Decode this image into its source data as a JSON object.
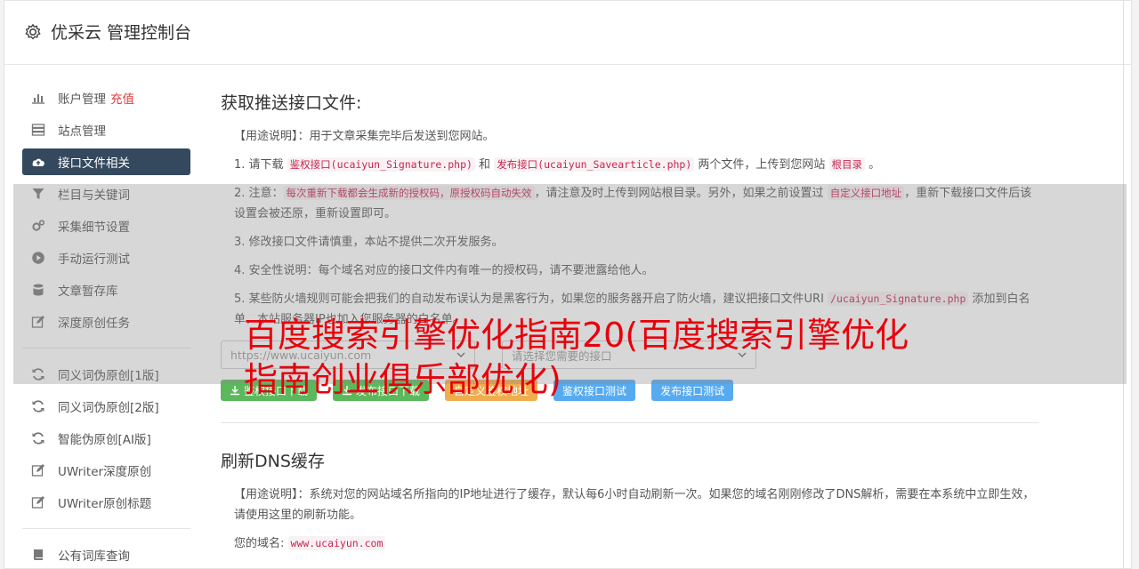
{
  "header": {
    "title": "优采云 管理控制台"
  },
  "sidebar": {
    "items": [
      {
        "label": "账户管理",
        "badge": "充值",
        "icon": "bar-chart-icon"
      },
      {
        "label": "站点管理",
        "icon": "server-icon"
      },
      {
        "label": "接口文件相关",
        "icon": "cloud-upload-icon",
        "active": true
      },
      {
        "label": "栏目与关键词",
        "icon": "filter-icon"
      },
      {
        "label": "采集细节设置",
        "icon": "cogs-icon"
      },
      {
        "label": "手动运行测试",
        "icon": "play-icon"
      },
      {
        "label": "文章暂存库",
        "icon": "database-icon"
      },
      {
        "label": "深度原创任务",
        "icon": "edit-icon"
      },
      {
        "label": "同义词伪原创[1版]",
        "icon": "refresh-icon"
      },
      {
        "label": "同义词伪原创[2版]",
        "icon": "refresh-icon"
      },
      {
        "label": "智能伪原创[AI版]",
        "icon": "refresh-icon"
      },
      {
        "label": "UWriter深度原创",
        "icon": "edit-icon"
      },
      {
        "label": "UWriter原创标题",
        "icon": "edit-icon"
      },
      {
        "label": "公有词库查询",
        "icon": "book-icon"
      }
    ]
  },
  "section1": {
    "title": "获取推送接口文件:",
    "usage": "【用途说明】：用于文章采集完毕后发送到您网站。",
    "step1": {
      "pre": "1. 请下载 ",
      "code1": "鉴权接口(ucaiyun_Signature.php)",
      "mid": " 和 ",
      "code2": "发布接口(ucaiyun_Savearticle.php)",
      "post": " 两个文件，上传到您网站 ",
      "code3": "根目录",
      "end": " 。"
    },
    "step2": {
      "pre": "2. 注意：",
      "code1": "每次重新下载都会生成新的授权码，原授权码自动失效",
      "mid": "，请注意及时上传到网站根目录。另外，如果之前设置过 ",
      "code2": "自定义接口地址",
      "post": "，重新下载接口文件后该设置会被还原，重新设置即可。"
    },
    "step3": "3. 修改接口文件请慎重，本站不提供二次开发服务。",
    "step4": "4. 安全性说明：每个域名对应的接口文件内有唯一的授权码，请不要泄露给他人。",
    "step5": {
      "pre": "5. 某些防火墙规则可能会把我们的自动发布误认为是黑客行为，如果您的服务器开启了防火墙，建议把接口文件URI ",
      "code1": "/ucaiyun_Signature.php",
      "post": " 添加到白名单，本站服务器IP也加入您服务器的白名单。"
    },
    "select_site": "https://www.ucaiyun.com",
    "select_api": "请选择您需要的接口",
    "buttons": {
      "sig_download": "鉴权接口下载",
      "pub_download": "发布接口下载",
      "custom_sig": "自定义鉴权地址",
      "sig_test": "鉴权接口测试",
      "pub_test": "发布接口测试"
    }
  },
  "section2": {
    "title": "刷新DNS缓存",
    "usage": "【用途说明】：系统对您的网站域名所指向的IP地址进行了缓存，默认每6小时自动刷新一次。如果您的域名刚刚修改了DNS解析，需要在本系统中立即生效，请使用这里的刷新功能。",
    "domain_label": "您的域名:",
    "domain_value": "www.ucaiyun.com"
  },
  "overlay": {
    "title": "百度搜索引擎优化指南20(百度搜索引擎优化指南创业俱乐部优化)"
  },
  "colors": {
    "sidebar_active": "#34495e",
    "accent_red": "#e8000b",
    "green": "#5cb85c",
    "orange": "#f0ad4e",
    "blue": "#5bc0de"
  }
}
